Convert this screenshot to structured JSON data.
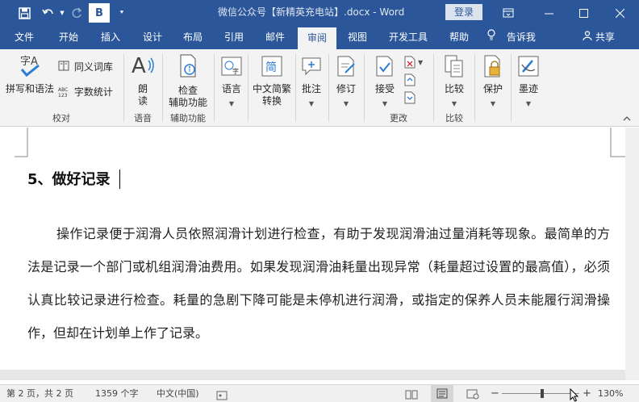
{
  "title_bar": {
    "document_title": "微信公众号【新精英充电站】.docx - Word",
    "login_label": "登录",
    "quick_access": {
      "save_icon": "save-icon",
      "undo_icon": "undo-icon",
      "redo_icon": "redo-icon",
      "bold_label": "B",
      "customize_icon": "chevron-down-icon"
    },
    "window_controls": [
      "ribbon-display-icon",
      "minimize-icon",
      "maximize-icon",
      "close-icon"
    ]
  },
  "tabs": [
    {
      "label": "文件"
    },
    {
      "label": "开始"
    },
    {
      "label": "插入"
    },
    {
      "label": "设计"
    },
    {
      "label": "布局"
    },
    {
      "label": "引用"
    },
    {
      "label": "邮件"
    },
    {
      "label": "审阅",
      "active": true
    },
    {
      "label": "视图"
    },
    {
      "label": "开发工具"
    },
    {
      "label": "帮助"
    }
  ],
  "tell_me": {
    "label": "告诉我",
    "icon": "lightbulb-icon"
  },
  "share": {
    "label": "共享",
    "icon": "person-icon"
  },
  "ribbon": {
    "proofing": {
      "group_label": "校对",
      "spelling_label": "拼写和语法",
      "thesaurus_label": "同义词库",
      "wordcount_label": "字数统计",
      "spelling_icon_text": "字A",
      "wordcount_icon_text": "ABC 123"
    },
    "speech": {
      "group_label": "语音",
      "read_aloud_label": "朗\n读"
    },
    "accessibility": {
      "group_label": "辅助功能",
      "check_label": "检查\n辅助功能"
    },
    "language": {
      "label": "语言"
    },
    "chinese_conversion": {
      "label": "中文简繁\n转换",
      "icon_text": "简"
    },
    "comments": {
      "label": "批注"
    },
    "tracking": {
      "label": "修订"
    },
    "changes": {
      "group_label": "更改",
      "accept_label": "接受"
    },
    "compare": {
      "group_label": "比较",
      "compare_label": "比较"
    },
    "protect": {
      "label": "保护"
    },
    "ink": {
      "label": "墨迹"
    }
  },
  "document": {
    "heading": "5、做好记录",
    "paragraph": "操作记录便于润滑人员依照润滑计划进行检查，有助于发现润滑油过量消耗等现象。最简单的方法是记录一个部门或机组润滑油费用。如果发现润滑油耗量出现异常（耗量超过设置的最高值），必须认真比较记录进行检查。耗量的急剧下降可能是未停机进行润滑，或指定的保养人员未能履行润滑操作，但却在计划单上作了记录。"
  },
  "status_bar": {
    "page": "第 2 页，共 2 页",
    "words": "1359 个字",
    "language": "中文(中国)",
    "zoom_minus": "−",
    "zoom_plus": "+",
    "zoom": "130%",
    "zoom_level": 1.3
  },
  "colors": {
    "accent": "#2b579a",
    "ribbon_bg": "#f3f3f3",
    "status_bg": "#f0f0f0"
  }
}
